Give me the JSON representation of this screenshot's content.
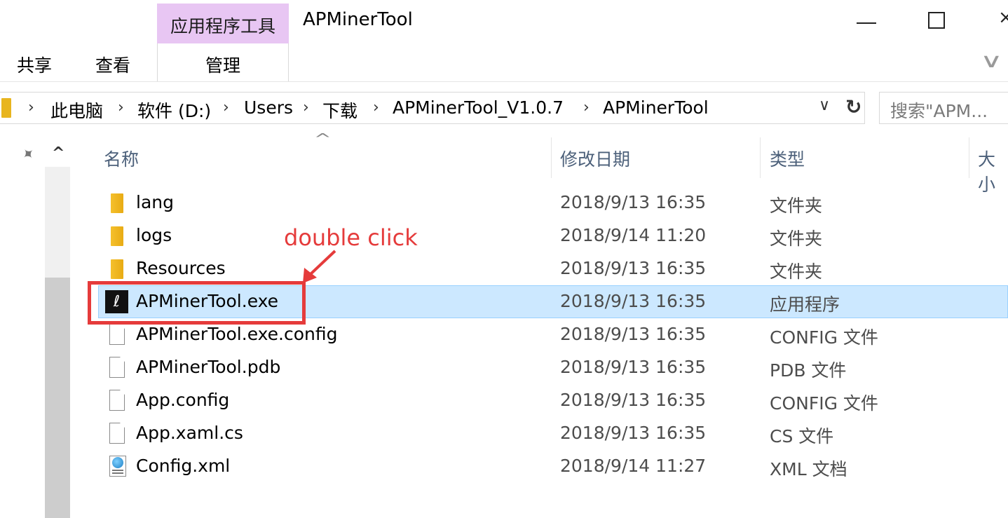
{
  "ribbon": {
    "contextual_tab_label": "应用程序工具",
    "window_title": "APMinerTool",
    "tabs": [
      "共享",
      "查看"
    ],
    "manage_tab": "管理",
    "minimize": "—",
    "close_partial": "×"
  },
  "address_bar": {
    "breadcrumbs": [
      "此电脑",
      "软件 (D:)",
      "Users",
      "下载",
      "APMinerTool_V1.0.7",
      "APMinerTool"
    ],
    "search_placeholder": "搜索\"APM..."
  },
  "columns": {
    "name": "名称",
    "modified": "修改日期",
    "type": "类型",
    "size_partial": "大小"
  },
  "files": [
    {
      "name": "lang",
      "modified": "2018/9/13 16:35",
      "type": "文件夹",
      "icon": "folder-icon"
    },
    {
      "name": "logs",
      "modified": "2018/9/14 11:20",
      "type": "文件夹",
      "icon": "folder-icon"
    },
    {
      "name": "Resources",
      "modified": "2018/9/13 16:35",
      "type": "文件夹",
      "icon": "folder-icon"
    },
    {
      "name": "APMinerTool.exe",
      "modified": "2018/9/13 16:35",
      "type": "应用程序",
      "icon": "app-exe-icon",
      "selected": true
    },
    {
      "name": "APMinerTool.exe.config",
      "modified": "2018/9/13 16:35",
      "type": "CONFIG 文件",
      "icon": "file-icon"
    },
    {
      "name": "APMinerTool.pdb",
      "modified": "2018/9/13 16:35",
      "type": "PDB 文件",
      "icon": "file-icon"
    },
    {
      "name": "App.config",
      "modified": "2018/9/13 16:35",
      "type": "CONFIG 文件",
      "icon": "file-icon"
    },
    {
      "name": "App.xaml.cs",
      "modified": "2018/9/13 16:35",
      "type": "CS 文件",
      "icon": "file-icon"
    },
    {
      "name": "Config.xml",
      "modified": "2018/9/14 11:27",
      "type": "XML 文档",
      "icon": "xml-file-icon"
    }
  ],
  "annotation": {
    "text": "double click",
    "color": "#e53b3b"
  },
  "colors": {
    "selection_bg": "#cce8ff",
    "contextual_tab_bg": "#e8c6f3",
    "folder": "#f0b824"
  }
}
